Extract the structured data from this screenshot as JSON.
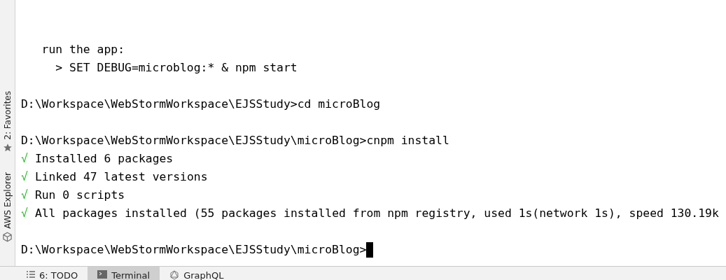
{
  "side_tabs": [
    {
      "label": "2: Favorites",
      "kind": "star"
    },
    {
      "label": "AWS Explorer",
      "kind": "cube"
    }
  ],
  "terminal": {
    "lines": [
      {
        "kind": "blank"
      },
      {
        "kind": "text",
        "text": "   run the app:"
      },
      {
        "kind": "text",
        "text": "     > SET DEBUG=microblog:* & npm start"
      },
      {
        "kind": "blank"
      },
      {
        "kind": "text",
        "text": "D:\\Workspace\\WebStormWorkspace\\EJSStudy>cd microBlog"
      },
      {
        "kind": "blank"
      },
      {
        "kind": "text",
        "text": "D:\\Workspace\\WebStormWorkspace\\EJSStudy\\microBlog>cnpm install"
      },
      {
        "kind": "success",
        "mark": "√",
        "text": "Installed 6 packages"
      },
      {
        "kind": "success",
        "mark": "√",
        "text": "Linked 47 latest versions"
      },
      {
        "kind": "success",
        "mark": "√",
        "text": "Run 0 scripts"
      },
      {
        "kind": "success",
        "mark": "√",
        "text": "All packages installed (55 packages installed from npm registry, used 1s(network 1s), speed 130.19k"
      },
      {
        "kind": "blank"
      },
      {
        "kind": "prompt",
        "text": "D:\\Workspace\\WebStormWorkspace\\EJSStudy\\microBlog>",
        "cursor": true
      }
    ]
  },
  "bottom_tabs": [
    {
      "label": "6: TODO",
      "kind": "list",
      "selected": false
    },
    {
      "label": "Terminal",
      "kind": "terminal",
      "selected": true
    },
    {
      "label": "GraphQL",
      "kind": "graphql",
      "selected": false
    }
  ]
}
